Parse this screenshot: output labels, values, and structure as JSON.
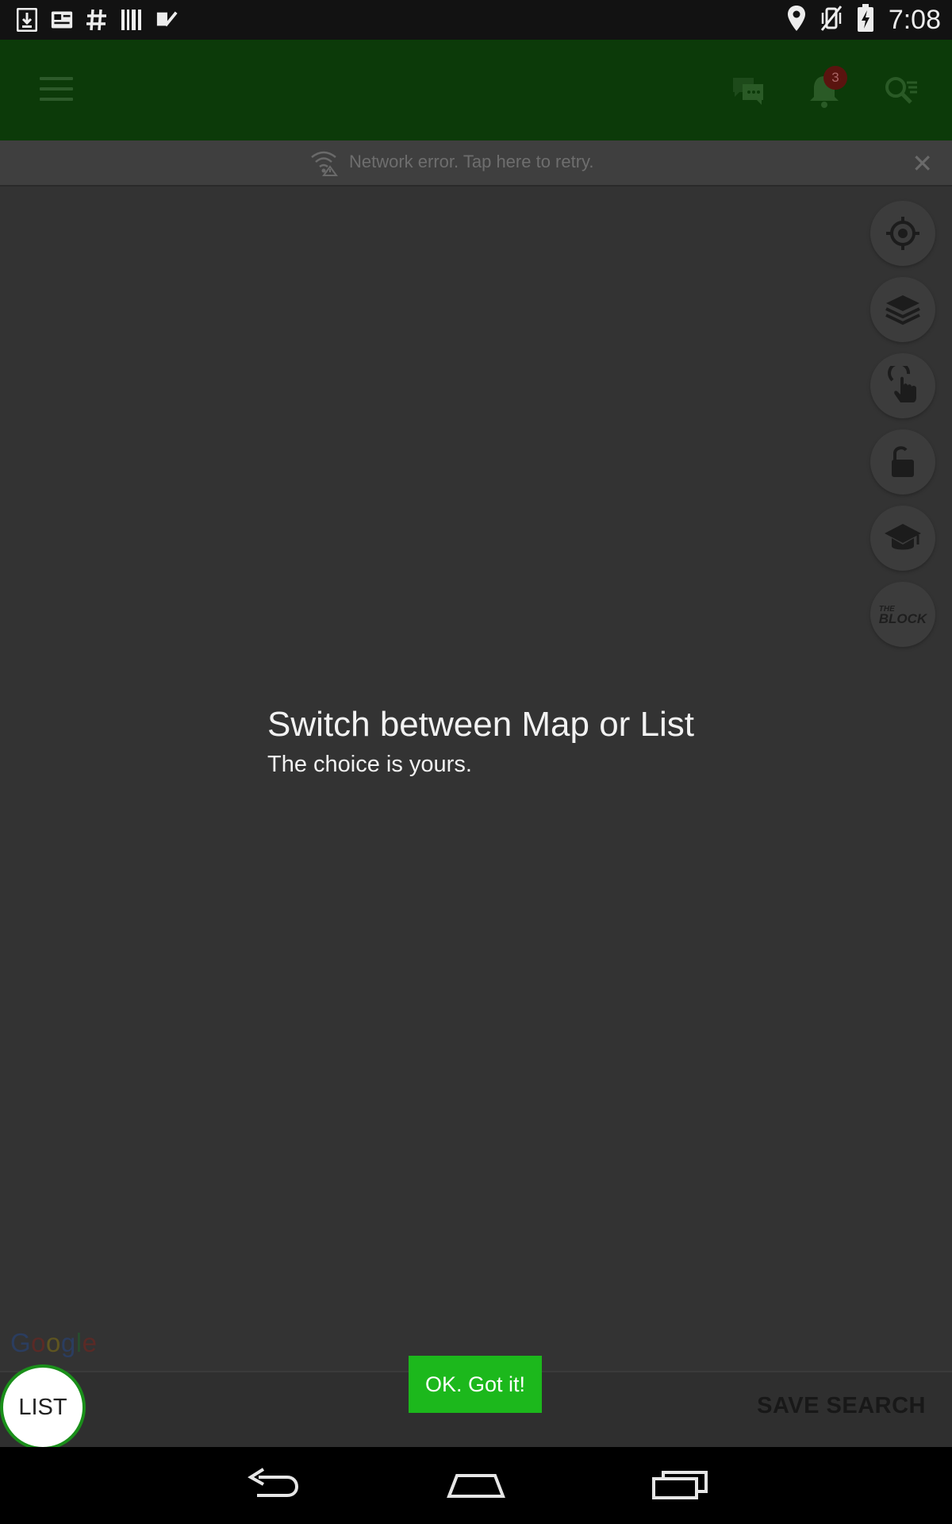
{
  "status_bar": {
    "time": "7:08",
    "left_icons": [
      "download-icon",
      "news-icon",
      "hashtag-icon",
      "barcode-icon",
      "task-check-icon"
    ],
    "right_icons": [
      "location-icon",
      "vibrate-off-icon",
      "battery-charging-icon"
    ]
  },
  "app_bar": {
    "icons": [
      "menu-icon",
      "chat-icon",
      "notifications-icon",
      "search-icon"
    ],
    "notification_count": "3",
    "color": "#0c3a09"
  },
  "network_banner": {
    "text": "Network error. Tap here to retry.",
    "close_glyph": "✕"
  },
  "map_controls": [
    "my-location-icon",
    "layers-icon",
    "draw-icon",
    "lock-icon",
    "school-icon",
    "the-block-icon"
  ],
  "the_block_label": {
    "top": "THE",
    "bottom": "BLOCK"
  },
  "tip": {
    "title": "Switch between Map or List",
    "subtitle": "The choice is yours."
  },
  "map_attribution": "Google",
  "bottom_bar": {
    "list_label": "LIST",
    "ok_label": "OK. Got it!",
    "save_search_label": "SAVE SEARCH"
  },
  "colors": {
    "accent_green": "#1cb81c",
    "overlay_background": "#333333"
  },
  "nav_bar": [
    "back-icon",
    "home-icon",
    "recents-icon"
  ]
}
